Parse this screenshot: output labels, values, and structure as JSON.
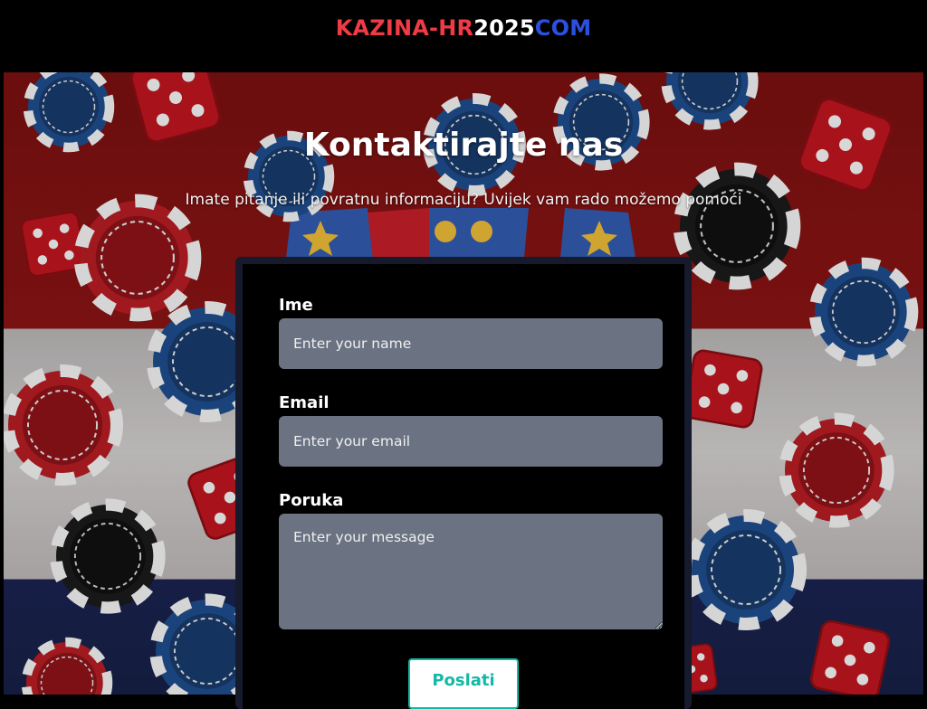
{
  "header": {
    "logo_part1": "KAZINA-HR",
    "logo_part2": "2025",
    "logo_part3": "COM"
  },
  "hero": {
    "title": "Kontaktirajte nas",
    "subtitle": "Imate pitanje ili povratnu informaciju? Uvijek vam rado možemo pomoći"
  },
  "form": {
    "name_label": "Ime",
    "name_placeholder": "Enter your name",
    "email_label": "Email",
    "email_placeholder": "Enter your email",
    "message_label": "Poruka",
    "message_placeholder": "Enter your message",
    "submit_label": "Poslati"
  },
  "colors": {
    "logo_red": "#ef3b45",
    "logo_blue": "#2d4fe0",
    "accent_teal": "#14b8a6",
    "input_bg": "#6b7282"
  }
}
